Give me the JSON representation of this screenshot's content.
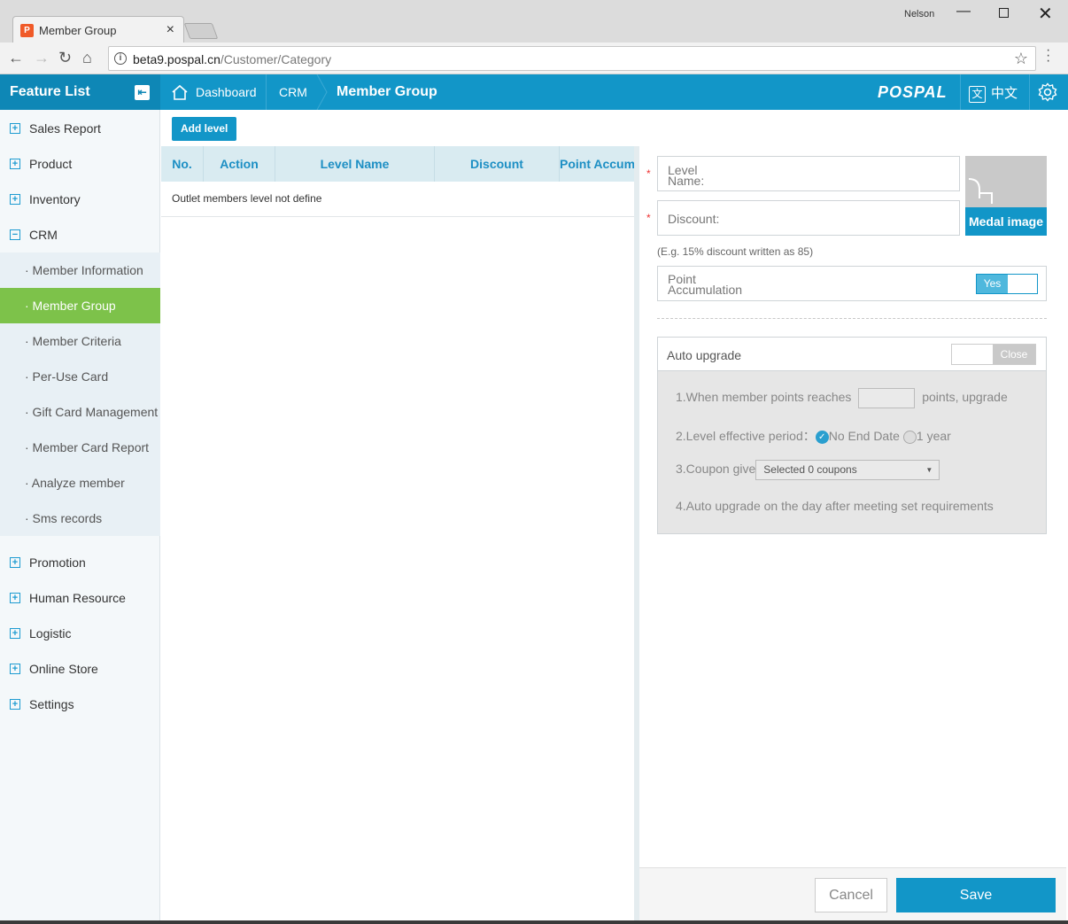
{
  "browser": {
    "tab_title": "Member Group",
    "user": "Nelson",
    "url_host": "beta9.pospal.cn",
    "url_path": "/Customer/Category"
  },
  "header": {
    "feature_list": "Feature List",
    "breadcrumb_dashboard": "Dashboard",
    "breadcrumb_crm": "CRM",
    "page_title": "Member Group",
    "logo": "POSPAL",
    "language": "中文"
  },
  "sidebar": {
    "top_items": [
      {
        "label": "Sales Report"
      },
      {
        "label": "Product"
      },
      {
        "label": "Inventory"
      },
      {
        "label": "CRM"
      }
    ],
    "crm_items": [
      {
        "label": "· Member Information"
      },
      {
        "label": "· Member Group"
      },
      {
        "label": "· Member Criteria"
      },
      {
        "label": "· Per-Use Card"
      },
      {
        "label": "· Gift Card Management"
      },
      {
        "label": "· Member Card Report"
      },
      {
        "label": "· Analyze member"
      },
      {
        "label": "· Sms records"
      }
    ],
    "bottom_items": [
      {
        "label": "Promotion"
      },
      {
        "label": "Human Resource"
      },
      {
        "label": "Logistic"
      },
      {
        "label": "Online Store"
      },
      {
        "label": "Settings"
      }
    ]
  },
  "table": {
    "add_button": "Add level",
    "columns": [
      "No.",
      "Action",
      "Level Name",
      "Discount",
      "Point Accumulation"
    ],
    "empty_message": "Outlet members level not define"
  },
  "form": {
    "level_name_label": "Level Name:",
    "discount_label": "Discount:",
    "discount_hint": "(E.g. 15% discount written as 85)",
    "medal_label": "Medal image",
    "point_accumulation_label": "Point Accumulation",
    "point_toggle": "Yes",
    "auto_upgrade_label": "Auto upgrade",
    "auto_toggle": "Close",
    "rule1_prefix": "1.When member points reaches",
    "rule1_suffix": "points, upgrade",
    "rule2_prefix": "2.Level effective period：",
    "rule2_option1": "No End Date",
    "rule2_option2": "1 year",
    "rule3_prefix": "3.Coupon give",
    "rule3_select": "Selected 0 coupons",
    "rule4": "4.Auto upgrade on the day after meeting set requirements"
  },
  "footer": {
    "cancel": "Cancel",
    "save": "Save"
  }
}
